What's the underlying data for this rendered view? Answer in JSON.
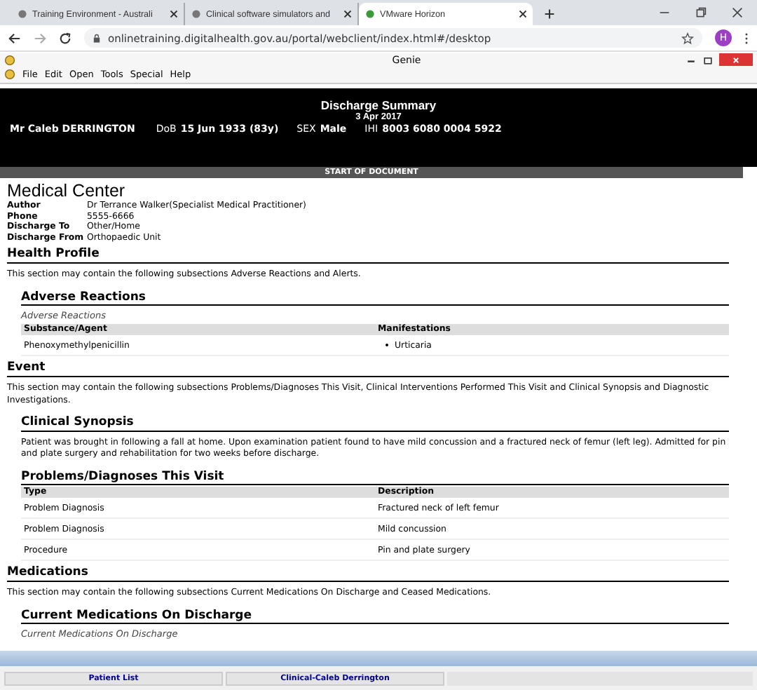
{
  "browser": {
    "tabs": [
      {
        "label": "Training Environment - Australi",
        "selected": false
      },
      {
        "label": "Clinical software simulators and",
        "selected": false
      },
      {
        "label": "VMware Horizon",
        "selected": true
      }
    ],
    "url": "onlinetraining.digitalhealth.gov.au/portal/webclient/index.html#/desktop",
    "avatar": "H"
  },
  "app": {
    "title": "Genie",
    "menu": [
      "File",
      "Edit",
      "Open",
      "Tools",
      "Special",
      "Help"
    ]
  },
  "document": {
    "title": "Discharge Summary",
    "date": "3 Apr 2017",
    "patient": {
      "name": "Mr Caleb DERRINGTON",
      "fields": [
        {
          "label": "DoB",
          "value": "15 Jun 1933 (83y)"
        },
        {
          "label": "SEX",
          "value": "Male"
        },
        {
          "label": "IHI",
          "value": "8003 6080 0004 5922"
        }
      ]
    },
    "start_bar": "START OF DOCUMENT",
    "organisation": "Medical Center",
    "details": [
      {
        "label": "Author",
        "value": "Dr Terrance Walker(Specialist Medical Practitioner)"
      },
      {
        "label": "Phone",
        "value": "5555-6666"
      },
      {
        "label": "Discharge To",
        "value": "Other/Home"
      },
      {
        "label": "Discharge From",
        "value": "Orthopaedic Unit"
      }
    ],
    "sections": [
      {
        "title": "Health Profile",
        "intro": "This section may contain the following subsections Adverse Reactions and Alerts.",
        "children": [
          {
            "kind": "table",
            "title": "Adverse Reactions",
            "caption": "Adverse Reactions",
            "columns": [
              "Substance/Agent",
              "Manifestations"
            ],
            "rows": [
              {
                "cells": [
                  "Phenoxymethylpenicillin"
                ],
                "bullets": [
                  "Urticaria"
                ]
              }
            ]
          }
        ]
      },
      {
        "title": "Event",
        "intro": "This section may contain the following subsections Problems/Diagnoses This Visit, Clinical Interventions Performed This Visit and Clinical Synopsis and Diagnostic Investigations.",
        "children": [
          {
            "kind": "text",
            "title": "Clinical Synopsis",
            "text": "Patient was brought in following a fall at home. Upon examination patient found to have mild concussion and a fractured neck of femur (left leg). Admitted for pin and plate surgery and rehabilitation for two weeks before discharge."
          },
          {
            "kind": "table",
            "title": "Problems/Diagnoses This Visit",
            "columns": [
              "Type",
              "Description"
            ],
            "rows": [
              {
                "cells": [
                  "Problem Diagnosis",
                  "Fractured neck of left femur"
                ]
              },
              {
                "cells": [
                  "Problem Diagnosis",
                  "Mild concussion"
                ]
              },
              {
                "cells": [
                  "Procedure",
                  "Pin and plate surgery"
                ]
              }
            ]
          }
        ]
      },
      {
        "title": "Medications",
        "intro": "This section may contain the following subsections Current Medications On Discharge and Ceased Medications.",
        "children": [
          {
            "kind": "caption",
            "title": "Current Medications On Discharge",
            "caption": "Current Medications On Discharge"
          }
        ]
      }
    ]
  },
  "bottom_tabs": [
    "Patient List",
    "Clinical-Caleb Derrington"
  ]
}
